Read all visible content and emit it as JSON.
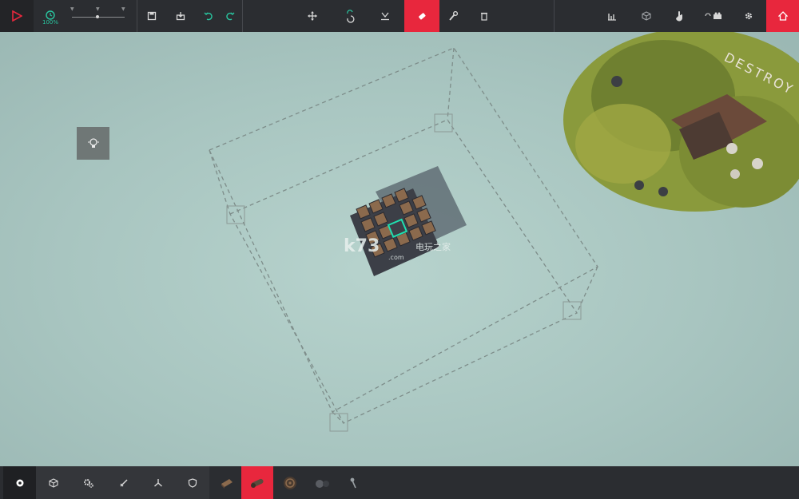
{
  "toolbar": {
    "sim_speed": "100%",
    "top_tools": [
      "play",
      "time-scale",
      "save",
      "load",
      "undo",
      "redo",
      "translate",
      "rotate",
      "snap",
      "eraser",
      "wrench",
      "trash",
      "stats",
      "view-cube",
      "mouse-input",
      "key-mapper",
      "settings",
      "home"
    ]
  },
  "bottombar": {
    "categories": [
      "basic",
      "blocks",
      "mechanical",
      "weapons",
      "flight",
      "armour"
    ],
    "parts": [
      "wooden-block",
      "cannon",
      "wheel",
      "bomb",
      "spike-ball"
    ],
    "selected_part": "cannon"
  },
  "scene": {
    "level_sign": "DESTROY",
    "watermark_main": "k73",
    "watermark_cn": "电玩之家",
    "watermark_sub": ".com"
  },
  "colors": {
    "accent_red": "#e8273d",
    "accent_teal": "#29c6a0",
    "toolbar_bg": "#2b2d31"
  }
}
